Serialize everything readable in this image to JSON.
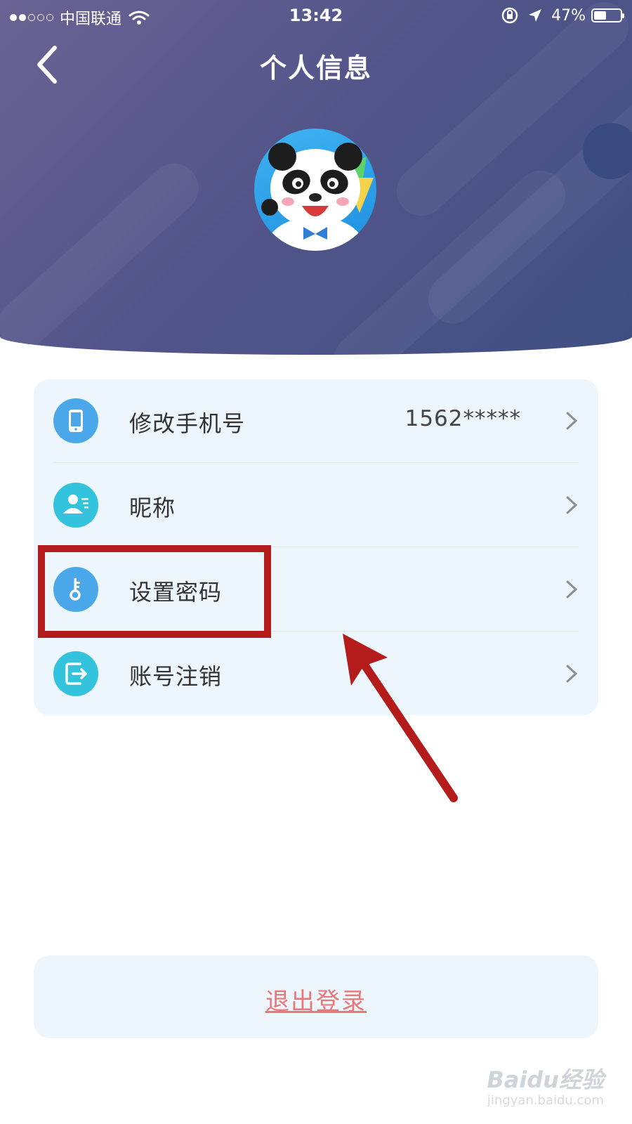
{
  "status_bar": {
    "carrier": "中国联通",
    "time": "13:42",
    "battery_percent": "47%",
    "battery_level": 0.47,
    "signal_bars": 2
  },
  "header": {
    "title": "个人信息",
    "back_icon": "chevron-left-icon"
  },
  "menu": {
    "items": [
      {
        "label": "修改手机号",
        "value": "1562*****",
        "icon": "phone-icon",
        "icon_color": "#4aa8ea"
      },
      {
        "label": "昵称",
        "value": "",
        "icon": "user-card-icon",
        "icon_color": "#33c3dd"
      },
      {
        "label": "设置密码",
        "value": "",
        "icon": "key-icon",
        "icon_color": "#4aa8ea"
      },
      {
        "label": "账号注销",
        "value": "",
        "icon": "exit-icon",
        "icon_color": "#33c3dd"
      }
    ]
  },
  "logout": {
    "label": "退出登录"
  },
  "watermark": {
    "brand": "Baidu经验",
    "url": "jingyan.baidu.com"
  },
  "colors": {
    "header": "#53558a",
    "card": "#eef6fd",
    "logout_text": "#e8787a",
    "annotation": "#b41c1c"
  }
}
